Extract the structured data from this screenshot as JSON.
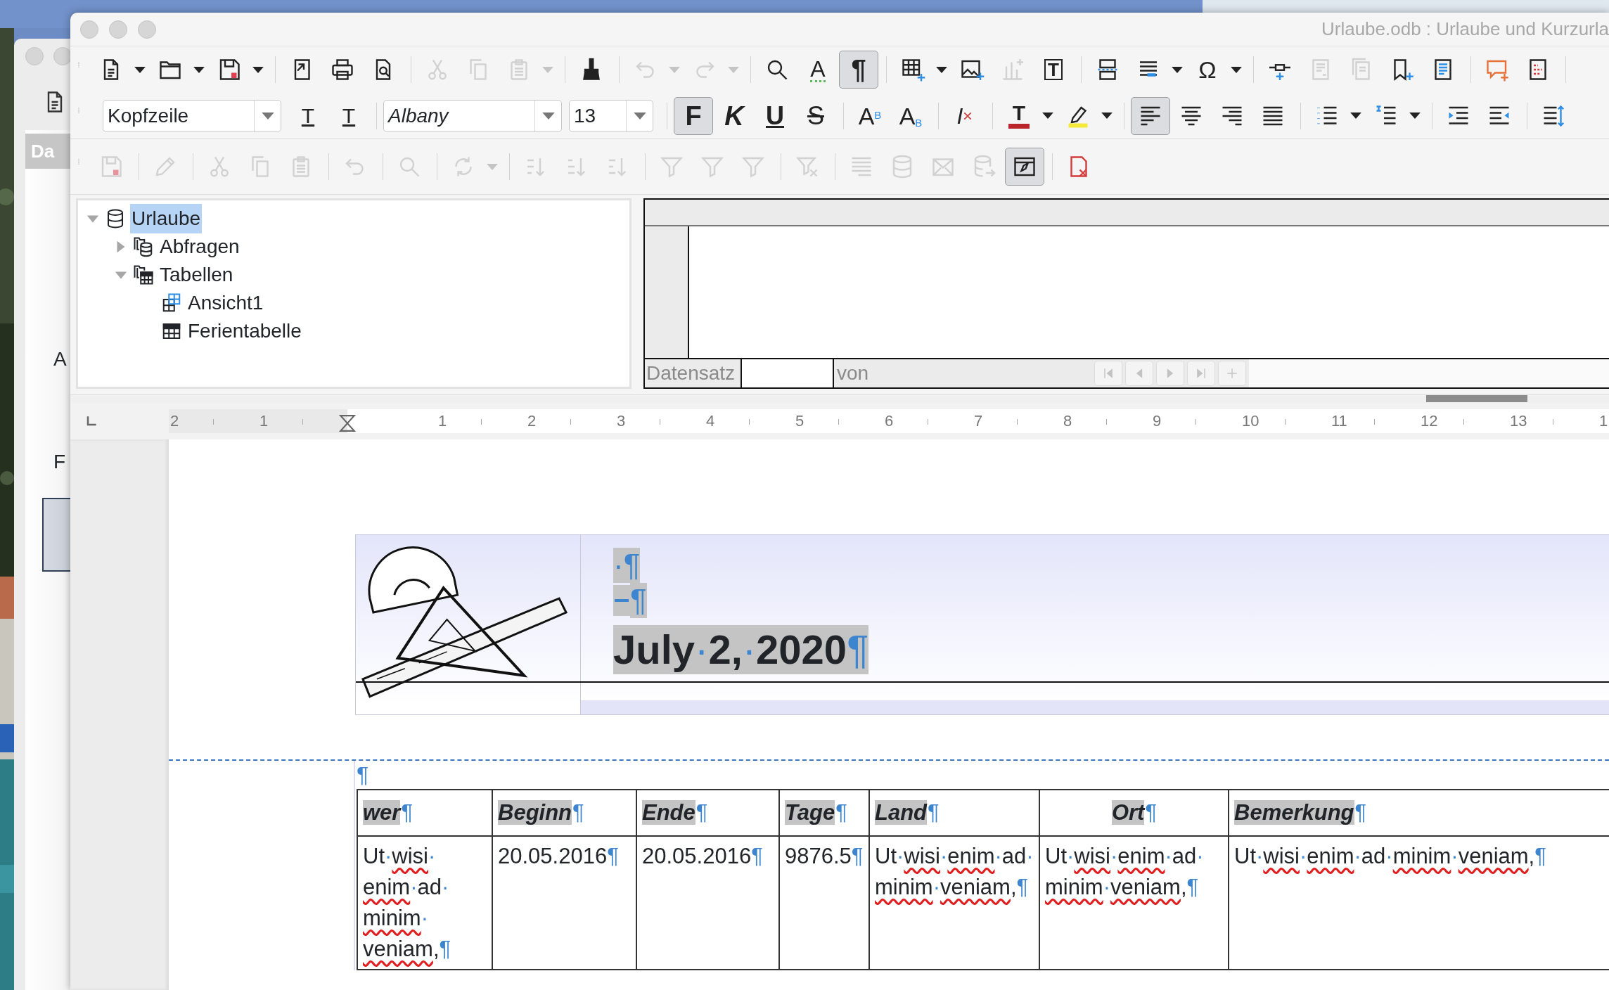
{
  "back_window": {
    "tab": "Da",
    "labels": [
      "A",
      "F"
    ]
  },
  "window": {
    "title": "Urlaube.odb : Urlaube und Kurzurla"
  },
  "toolbars": [
    {
      "items": [
        {
          "kind": "split",
          "disabled": false,
          "pressed": false
        },
        {
          "kind": "split",
          "disabled": false,
          "pressed": false
        },
        {
          "kind": "split",
          "disabled": false,
          "pressed": false
        },
        {
          "kind": "separator"
        },
        {
          "kind": "button",
          "disabled": false,
          "pressed": false
        },
        {
          "kind": "button",
          "disabled": false,
          "pressed": false
        },
        {
          "kind": "button",
          "disabled": false,
          "pressed": false
        },
        {
          "kind": "separator"
        },
        {
          "kind": "button",
          "disabled": true,
          "pressed": false
        },
        {
          "kind": "button",
          "disabled": true,
          "pressed": false
        },
        {
          "kind": "split",
          "disabled": true,
          "pressed": false
        },
        {
          "kind": "separator"
        },
        {
          "kind": "button",
          "disabled": false,
          "pressed": false
        },
        {
          "kind": "separator"
        },
        {
          "kind": "split",
          "disabled": true,
          "pressed": false
        },
        {
          "kind": "split",
          "disabled": true,
          "pressed": false
        },
        {
          "kind": "separator"
        },
        {
          "kind": "button",
          "disabled": false,
          "pressed": false
        },
        {
          "kind": "button",
          "disabled": false,
          "pressed": false,
          "label": "A"
        },
        {
          "kind": "button",
          "disabled": false,
          "pressed": true,
          "label": "¶"
        },
        {
          "kind": "separator"
        },
        {
          "kind": "split",
          "disabled": false,
          "pressed": false
        },
        {
          "kind": "button",
          "disabled": false,
          "pressed": false
        },
        {
          "kind": "button",
          "disabled": true,
          "pressed": false
        },
        {
          "kind": "button",
          "disabled": false,
          "pressed": false,
          "label": "T"
        },
        {
          "kind": "separator"
        },
        {
          "kind": "button",
          "disabled": false,
          "pressed": false
        },
        {
          "kind": "split",
          "disabled": false,
          "pressed": false
        },
        {
          "kind": "split",
          "disabled": false,
          "pressed": false,
          "label": "Ω"
        },
        {
          "kind": "separator"
        },
        {
          "kind": "button",
          "disabled": false,
          "pressed": false
        },
        {
          "kind": "button",
          "disabled": true,
          "pressed": false
        },
        {
          "kind": "button",
          "disabled": true,
          "pressed": false
        },
        {
          "kind": "button",
          "disabled": false,
          "pressed": false
        },
        {
          "kind": "button",
          "disabled": false,
          "pressed": false
        },
        {
          "kind": "separator"
        },
        {
          "kind": "button",
          "disabled": false,
          "pressed": false
        },
        {
          "kind": "button",
          "disabled": false,
          "pressed": false
        },
        {
          "kind": "separator"
        }
      ]
    },
    {
      "items": [
        {
          "kind": "combo",
          "value": "Kopfzeile"
        },
        {
          "kind": "button",
          "disabled": false,
          "pressed": false,
          "label": "T"
        },
        {
          "kind": "button",
          "disabled": false,
          "pressed": false,
          "label": "T"
        },
        {
          "kind": "separator"
        },
        {
          "kind": "combo",
          "value": "Albany"
        },
        {
          "kind": "combo",
          "value": "13"
        },
        {
          "kind": "separator"
        },
        {
          "kind": "button",
          "disabled": false,
          "pressed": true,
          "label": "F"
        },
        {
          "kind": "button",
          "disabled": false,
          "pressed": false,
          "label": "K"
        },
        {
          "kind": "button",
          "disabled": false,
          "pressed": false,
          "label": "U"
        },
        {
          "kind": "button",
          "disabled": false,
          "pressed": false,
          "label": "S"
        },
        {
          "kind": "separator"
        },
        {
          "kind": "button",
          "disabled": false,
          "pressed": false,
          "label": "A$^{B}$"
        },
        {
          "kind": "button",
          "disabled": false,
          "pressed": false,
          "label": "A$_{B}$"
        },
        {
          "kind": "separator"
        },
        {
          "kind": "button",
          "disabled": false,
          "pressed": false,
          "label": "I"
        },
        {
          "kind": "separator"
        },
        {
          "kind": "split",
          "disabled": false,
          "pressed": false,
          "label": "T"
        },
        {
          "kind": "split",
          "disabled": false,
          "pressed": false
        },
        {
          "kind": "separator"
        },
        {
          "kind": "button",
          "disabled": false,
          "pressed": true
        },
        {
          "kind": "button",
          "disabled": false,
          "pressed": false
        },
        {
          "kind": "button",
          "disabled": false,
          "pressed": false
        },
        {
          "kind": "button",
          "disabled": false,
          "pressed": false
        },
        {
          "kind": "separator"
        },
        {
          "kind": "split",
          "disabled": false,
          "pressed": false
        },
        {
          "kind": "split",
          "disabled": false,
          "pressed": false
        },
        {
          "kind": "separator"
        },
        {
          "kind": "button",
          "disabled": false,
          "pressed": false
        },
        {
          "kind": "button",
          "disabled": false,
          "pressed": false
        },
        {
          "kind": "separator"
        },
        {
          "kind": "button",
          "disabled": false,
          "pressed": false
        }
      ]
    },
    {
      "items": [
        {
          "kind": "button",
          "disabled": true,
          "pressed": false
        },
        {
          "kind": "separator"
        },
        {
          "kind": "button",
          "disabled": true,
          "pressed": false
        },
        {
          "kind": "separator"
        },
        {
          "kind": "button",
          "disabled": true,
          "pressed": false
        },
        {
          "kind": "button",
          "disabled": true,
          "pressed": false
        },
        {
          "kind": "button",
          "disabled": true,
          "pressed": false
        },
        {
          "kind": "separator"
        },
        {
          "kind": "button",
          "disabled": true,
          "pressed": false
        },
        {
          "kind": "separator"
        },
        {
          "kind": "button",
          "disabled": true,
          "pressed": false
        },
        {
          "kind": "separator"
        },
        {
          "kind": "split",
          "disabled": true,
          "pressed": false
        },
        {
          "kind": "separator"
        },
        {
          "kind": "button",
          "disabled": true,
          "pressed": false
        },
        {
          "kind": "button",
          "disabled": true,
          "pressed": false
        },
        {
          "kind": "button",
          "disabled": true,
          "pressed": false
        },
        {
          "kind": "separator"
        },
        {
          "kind": "button",
          "disabled": true,
          "pressed": false
        },
        {
          "kind": "button",
          "disabled": true,
          "pressed": false
        },
        {
          "kind": "button",
          "disabled": true,
          "pressed": false
        },
        {
          "kind": "separator"
        },
        {
          "kind": "button",
          "disabled": true,
          "pressed": false
        },
        {
          "kind": "separator"
        },
        {
          "kind": "button",
          "disabled": true,
          "pressed": false
        },
        {
          "kind": "button",
          "disabled": true,
          "pressed": false
        },
        {
          "kind": "button",
          "disabled": true,
          "pressed": false
        },
        {
          "kind": "button",
          "disabled": true,
          "pressed": false
        },
        {
          "kind": "button",
          "disabled": false,
          "pressed": true
        },
        {
          "kind": "separator"
        },
        {
          "kind": "button",
          "disabled": false,
          "pressed": false
        }
      ]
    }
  ],
  "navigator": {
    "tree": [
      {
        "kind": "database",
        "label": "Urlaube",
        "selected": true,
        "expanded": true,
        "children": [
          {
            "kind": "queries",
            "label": "Abfragen",
            "selected": false,
            "expanded": false
          },
          {
            "kind": "tables",
            "label": "Tabellen",
            "selected": false,
            "expanded": true,
            "children": [
              {
                "kind": "view",
                "label": "Ansicht1",
                "selected": false
              },
              {
                "kind": "table",
                "label": "Ferientabelle",
                "selected": false
              }
            ]
          }
        ]
      }
    ]
  },
  "data_grid": {
    "record_label": "Datensatz",
    "of_label": "von",
    "nav_buttons": [
      {
        "kind": "first",
        "disabled": true
      },
      {
        "kind": "previous",
        "disabled": true
      },
      {
        "kind": "next",
        "disabled": true
      },
      {
        "kind": "last",
        "disabled": true
      },
      {
        "kind": "new",
        "disabled": true
      }
    ]
  },
  "ruler": {
    "marks": [
      {
        "kind": "number",
        "label": "2"
      },
      {
        "kind": "number",
        "label": "1"
      },
      {
        "kind": "indent"
      },
      {
        "kind": "number",
        "label": "1"
      },
      {
        "kind": "number",
        "label": "2"
      },
      {
        "kind": "number",
        "label": "3"
      },
      {
        "kind": "number",
        "label": "4"
      },
      {
        "kind": "number",
        "label": "5"
      },
      {
        "kind": "number",
        "label": "6"
      },
      {
        "kind": "number",
        "label": "7"
      },
      {
        "kind": "number",
        "label": "8"
      },
      {
        "kind": "number",
        "label": "9"
      },
      {
        "kind": "number",
        "label": "10"
      },
      {
        "kind": "number",
        "label": "11"
      },
      {
        "kind": "number",
        "label": "12"
      },
      {
        "kind": "number",
        "label": "13"
      },
      {
        "kind": "number",
        "label": "1"
      }
    ]
  },
  "header": {
    "lines": [
      {
        "text": "·¶",
        "tab_mark": false
      },
      {
        "text": "¶",
        "tab_mark": true
      }
    ],
    "date": "July·2,·2020¶"
  },
  "body_mark": "¶",
  "table": {
    "columns": [
      {
        "label": "wer¶",
        "centered": false
      },
      {
        "label": "Beginn¶",
        "centered": false
      },
      {
        "label": "Ende¶",
        "centered": false
      },
      {
        "label": "Tage¶",
        "centered": false
      },
      {
        "label": "Land¶",
        "centered": false
      },
      {
        "label": "Ort¶",
        "centered": true
      },
      {
        "label": "Bemerkung¶",
        "centered": false
      }
    ],
    "rows": [
      {
        "cells": [
          {
            "segments": [
              {
                "text": "Ut·",
                "misspelled": false
              },
              {
                "text": "wisi",
                "misspelled": true
              },
              {
                "text": "·",
                "misspelled": false
              },
              {
                "text": "enim",
                "misspelled": true
              },
              {
                "text": "·ad·",
                "misspelled": false
              },
              {
                "text": "minim",
                "misspelled": true
              },
              {
                "text": "·",
                "misspelled": false
              },
              {
                "text": "veniam",
                "misspelled": true
              },
              {
                "text": ",¶",
                "misspelled": false
              }
            ]
          },
          {
            "text": "20.05.2016¶"
          },
          {
            "text": "20.05.2016¶"
          },
          {
            "text": "9876.5¶"
          },
          {
            "segments": [
              {
                "text": "Ut·",
                "misspelled": false
              },
              {
                "text": "wisi",
                "misspelled": true
              },
              {
                "text": "·",
                "misspelled": false
              },
              {
                "text": "enim",
                "misspelled": true
              },
              {
                "text": "·ad·",
                "misspelled": false
              },
              {
                "text": "minim",
                "misspelled": true
              },
              {
                "text": "·",
                "misspelled": false
              },
              {
                "text": "veniam",
                "misspelled": true
              },
              {
                "text": ",¶",
                "misspelled": false
              }
            ]
          },
          {
            "segments": [
              {
                "text": "Ut·",
                "misspelled": false
              },
              {
                "text": "wisi",
                "misspelled": true
              },
              {
                "text": "·",
                "misspelled": false
              },
              {
                "text": "enim",
                "misspelled": true
              },
              {
                "text": "·ad·",
                "misspelled": false
              },
              {
                "text": "minim",
                "misspelled": true
              },
              {
                "text": "·",
                "misspelled": false
              },
              {
                "text": "veniam",
                "misspelled": true
              },
              {
                "text": ",¶",
                "misspelled": false
              }
            ]
          },
          {
            "segments": [
              {
                "text": "Ut·",
                "misspelled": false
              },
              {
                "text": "wisi",
                "misspelled": true
              },
              {
                "text": "·",
                "misspelled": false
              },
              {
                "text": "enim",
                "misspelled": true
              },
              {
                "text": "·ad·",
                "misspelled": false
              },
              {
                "text": "minim",
                "misspelled": true
              },
              {
                "text": "·",
                "misspelled": false
              },
              {
                "text": "veniam",
                "misspelled": true
              },
              {
                "text": ",¶",
                "misspelled": false
              }
            ]
          }
        ]
      }
    ]
  }
}
